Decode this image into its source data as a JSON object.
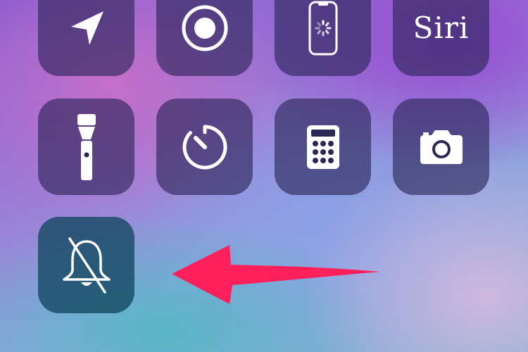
{
  "controls": [
    {
      "id": "location",
      "icon": "location-arrow-icon"
    },
    {
      "id": "screen-recording",
      "icon": "record-icon"
    },
    {
      "id": "screen-mirroring",
      "icon": "phone-loading-icon"
    },
    {
      "id": "siri",
      "icon": "siri-icon",
      "label": "Siri"
    },
    {
      "id": "flashlight",
      "icon": "flashlight-icon"
    },
    {
      "id": "timer",
      "icon": "timer-icon"
    },
    {
      "id": "calculator",
      "icon": "calculator-icon"
    },
    {
      "id": "camera",
      "icon": "camera-icon"
    },
    {
      "id": "silent-mode",
      "icon": "bell-slash-icon",
      "state": "on"
    }
  ],
  "colors": {
    "tile": "#2b2755",
    "mute_tile": "#124660",
    "icon": "#ffffff",
    "arrow": "#ff1f5a"
  }
}
